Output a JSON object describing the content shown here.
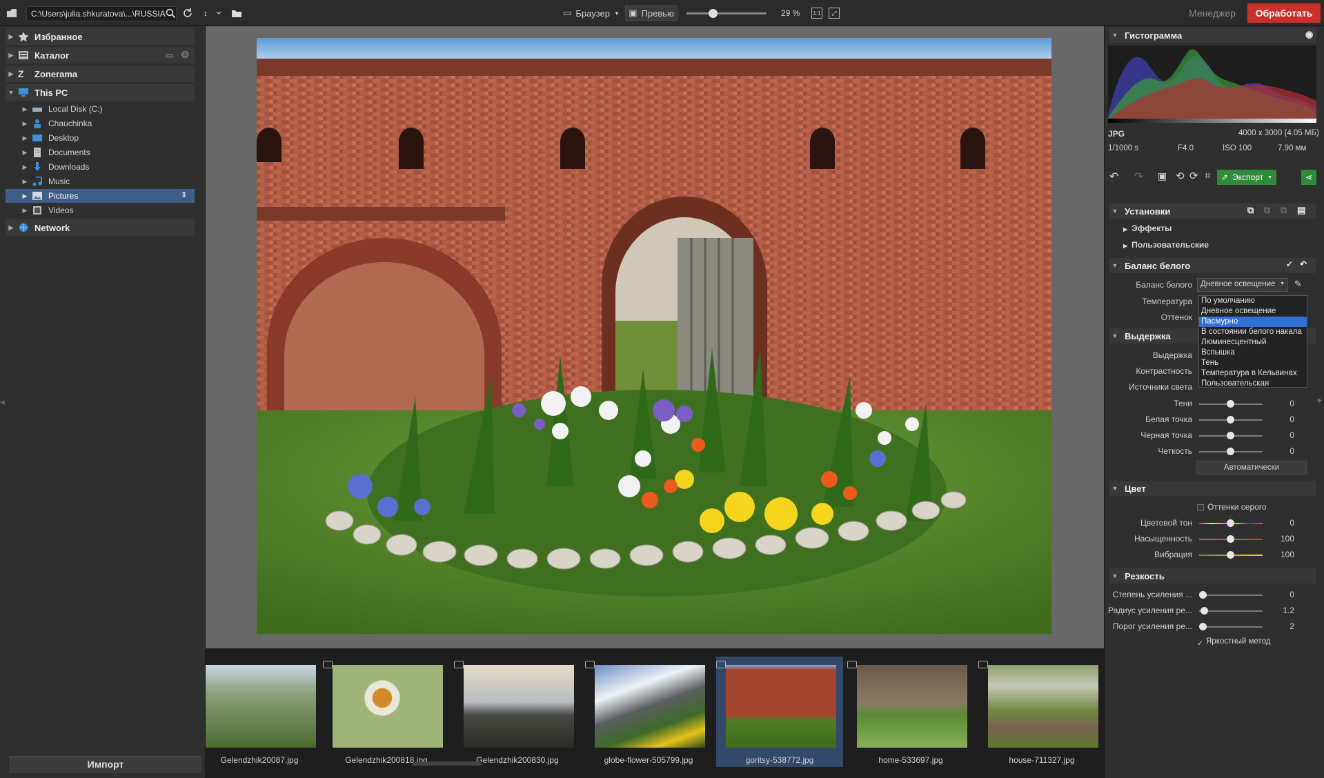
{
  "toolbar": {
    "path": "C:\\Users\\julia.shkuratova\\...\\RUSSIA",
    "browser_label": "Браузер",
    "preview_label": "Превью",
    "zoom": "29 %",
    "manager_label": "Менеджер",
    "process_label": "Обработать"
  },
  "left": {
    "favorites": "Избранное",
    "catalog": "Каталог",
    "zonerama": "Zonerama",
    "thispc": "This PC",
    "items": [
      "Local Disk (C:)",
      "Chauchinka",
      "Desktop",
      "Documents",
      "Downloads",
      "Music",
      "Pictures",
      "Videos"
    ],
    "network": "Network",
    "import_label": "Импорт"
  },
  "filmstrip": [
    {
      "name": "Gelendzhik20087.jpg"
    },
    {
      "name": "Gelendzhik200818.jpg"
    },
    {
      "name": "Gelendzhik200830.jpg"
    },
    {
      "name": "globe-flower-505799.jpg"
    },
    {
      "name": "goritsy-538772.jpg"
    },
    {
      "name": "home-533697.jpg"
    },
    {
      "name": "house-711327.jpg"
    }
  ],
  "right": {
    "histogram_title": "Гистограмма",
    "info": {
      "format": "JPG",
      "dims": "4000 x 3000 (4.05 МБ)",
      "shutter": "1/1000 s",
      "aperture": "F4.0",
      "iso": "ISO 100",
      "focal": "7.90 мм"
    },
    "export_label": "Экспорт",
    "presets_title": "Установки",
    "effects": "Эффекты",
    "custom": "Пользовательские",
    "wb_title": "Баланс белого",
    "wb_label": "Баланс белого",
    "wb_value": "Дневное освещение",
    "temperature_label": "Температура",
    "tint_label": "Оттенок",
    "wb_options": [
      "По умолчанию",
      "Дневное освещение",
      "Пасмурно",
      "В состоянии белого накала",
      "Люминесцентный",
      "Вспышка",
      "Тень",
      "Температура в Кельвинах",
      "Пользовательская"
    ],
    "exposure_title": "Выдержка",
    "exposure_rows": [
      {
        "label": "Выдержка",
        "value": ""
      },
      {
        "label": "Контрастность",
        "value": ""
      },
      {
        "label": "Источники света",
        "value": ""
      },
      {
        "label": "Тени",
        "value": "0"
      },
      {
        "label": "Белая точка",
        "value": "0"
      },
      {
        "label": "Черная точка",
        "value": "0"
      },
      {
        "label": "Четкость",
        "value": "0"
      }
    ],
    "auto_label": "Автоматически",
    "color_title": "Цвет",
    "grayscale_label": "Оттенки серого",
    "color_rows": [
      {
        "label": "Цветовой тон",
        "value": "0"
      },
      {
        "label": "Насыщенность",
        "value": "100"
      },
      {
        "label": "Вибрация",
        "value": "100"
      }
    ],
    "sharp_title": "Резкость",
    "sharp_rows": [
      {
        "label": "Степень усиления ...",
        "value": "0"
      },
      {
        "label": "Радиус усиления ре...",
        "value": "1.2"
      },
      {
        "label": "Порог усиления ре...",
        "value": "2"
      }
    ],
    "luma_label": "Яркостный метод"
  },
  "colors": {
    "accent": "#c9302c",
    "selection": "#3f5e86",
    "highlight": "#2f6fd6"
  }
}
